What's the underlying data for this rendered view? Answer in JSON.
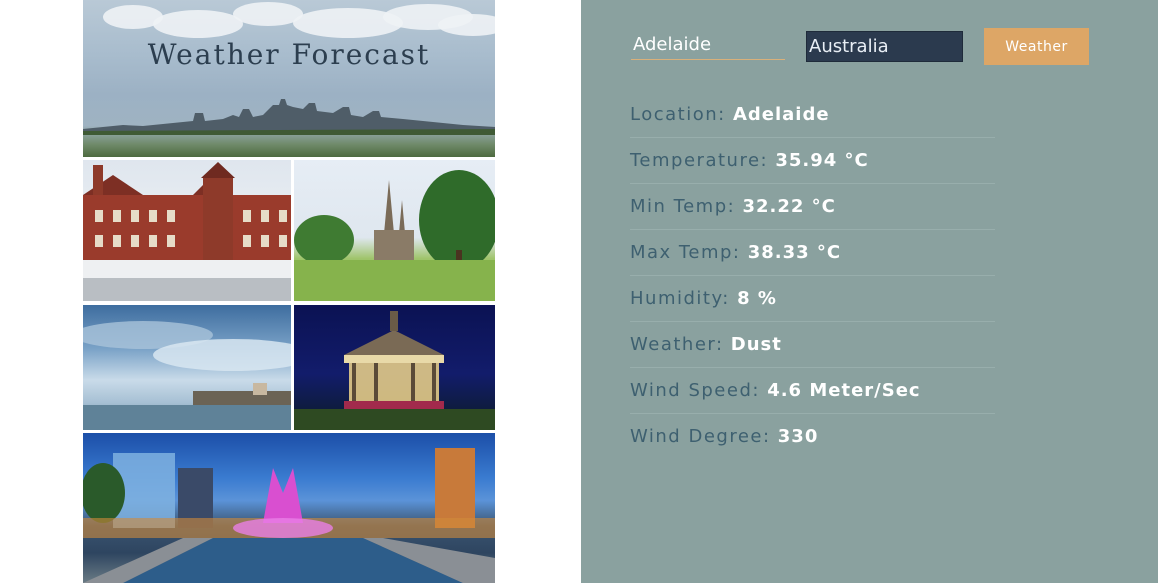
{
  "header": {
    "title": "Weather Forecast"
  },
  "search": {
    "city_value": "Adelaide",
    "country_value": "Australia",
    "button_label": "Weather"
  },
  "info": [
    {
      "label": "Location:",
      "value": "Adelaide"
    },
    {
      "label": "Temperature:",
      "value": "35.94 °C"
    },
    {
      "label": "Min Temp:",
      "value": "32.22 °C"
    },
    {
      "label": "Max Temp:",
      "value": "38.33 °C"
    },
    {
      "label": "Humidity:",
      "value": "8 %"
    },
    {
      "label": "Weather:",
      "value": "Dust"
    },
    {
      "label": "Wind Speed:",
      "value": "4.6 Meter/Sec"
    },
    {
      "label": "Wind Degree:",
      "value": "330"
    }
  ],
  "colors": {
    "panel_bg": "#8aa19f",
    "button_bg": "#dda666",
    "country_bg": "#2b3a4e",
    "label_color": "#3e6070",
    "value_color": "#ffffff"
  }
}
